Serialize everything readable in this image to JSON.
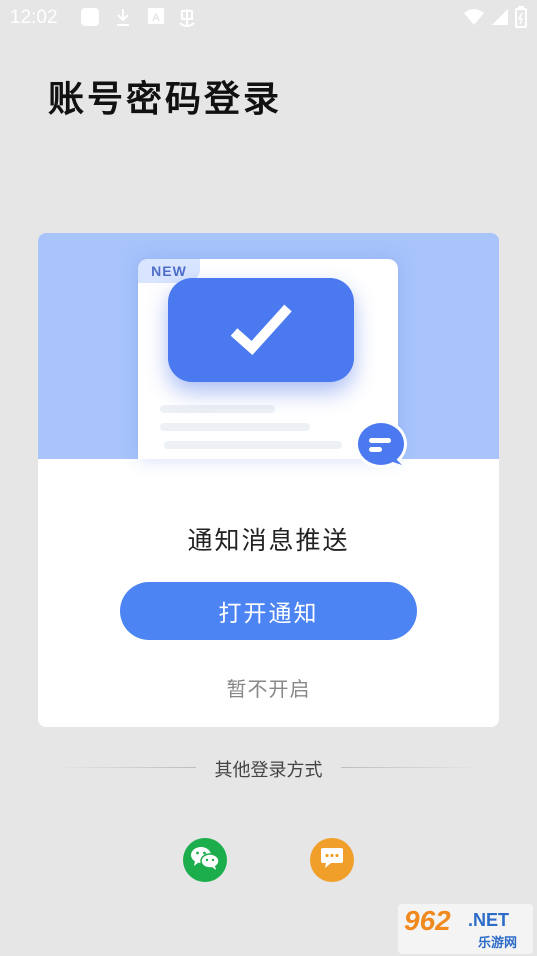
{
  "status_bar": {
    "time": "12:02",
    "icons": [
      "square-app-icon",
      "download-icon",
      "a-badge-icon",
      "bug-icon",
      "wifi-icon",
      "signal-icon",
      "battery-icon"
    ]
  },
  "page": {
    "title": "账号密码登录"
  },
  "card": {
    "badge": "NEW",
    "heading": "通知消息推送",
    "primary_button": "打开通知",
    "secondary_link": "暂不开启",
    "hero_icons": [
      "checkmark-icon",
      "message-bubble-icon"
    ]
  },
  "other_login": {
    "label": "其他登录方式",
    "options": [
      {
        "name": "wechat",
        "icon": "wechat-icon",
        "color": "#1cad4c"
      },
      {
        "name": "sms",
        "icon": "sms-icon",
        "color": "#f0a02a"
      }
    ]
  },
  "watermark": {
    "number": "962",
    "domain": ".NET",
    "sub": "乐游网"
  },
  "colors": {
    "accent": "#4d84f4",
    "hero_bg": "#a8c4fb",
    "page_bg": "#e6e6e6"
  }
}
